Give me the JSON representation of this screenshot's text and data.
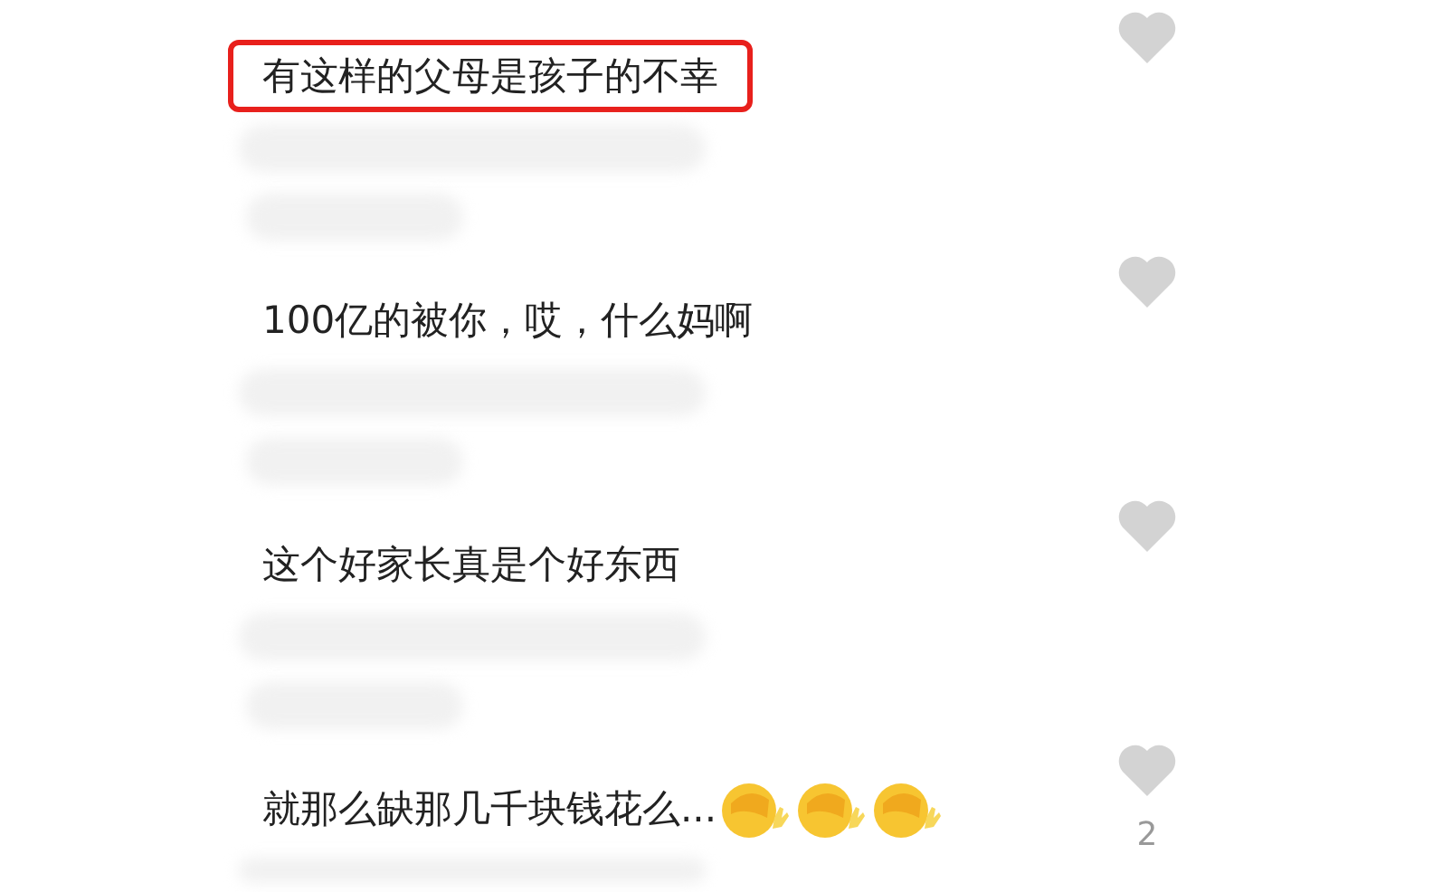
{
  "comments": [
    {
      "text": "有这样的父母是孩子的不幸",
      "highlighted": true,
      "liked": false
    },
    {
      "text": "100亿的被你，哎，什么妈啊",
      "highlighted": false,
      "liked": false
    },
    {
      "text": "这个好家长真是个好东西",
      "highlighted": false,
      "liked": false
    },
    {
      "text": "就那么缺那几千块钱花么...",
      "highlighted": false,
      "liked": false,
      "emojis": [
        {
          "kind": "facepalm"
        },
        {
          "kind": "facepalm"
        },
        {
          "kind": "facepalm"
        }
      ],
      "like_count": "2"
    }
  ]
}
